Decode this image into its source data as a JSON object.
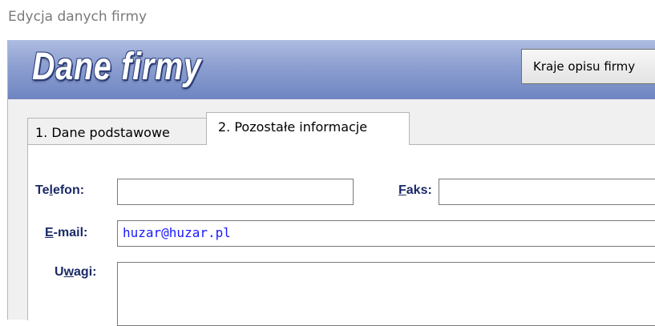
{
  "window": {
    "title": "Edycja danych firmy"
  },
  "header": {
    "title": "Dane firmy",
    "button_label": "Kraje opisu firmy"
  },
  "tabs": [
    {
      "label": "1. Dane podstawowe",
      "active": false
    },
    {
      "label": "2. Pozostałe informacje",
      "active": true
    }
  ],
  "form": {
    "telefon": {
      "label_pre": "Te",
      "label_key": "l",
      "label_post": "efon:",
      "value": ""
    },
    "faks": {
      "label_pre": "",
      "label_key": "F",
      "label_post": "aks:",
      "value": ""
    },
    "email": {
      "label_pre": "",
      "label_key": "E",
      "label_post": "-mail:",
      "value": "huzar@huzar.pl"
    },
    "uwagi": {
      "label_pre": "U",
      "label_key": "w",
      "label_post": "agi:",
      "value": ""
    }
  },
  "colors": {
    "header_gradient_top": "#aebce0",
    "header_gradient_bottom": "#6f86c3",
    "label_color": "#1b2a66",
    "field_text_color": "#1a1aff"
  }
}
